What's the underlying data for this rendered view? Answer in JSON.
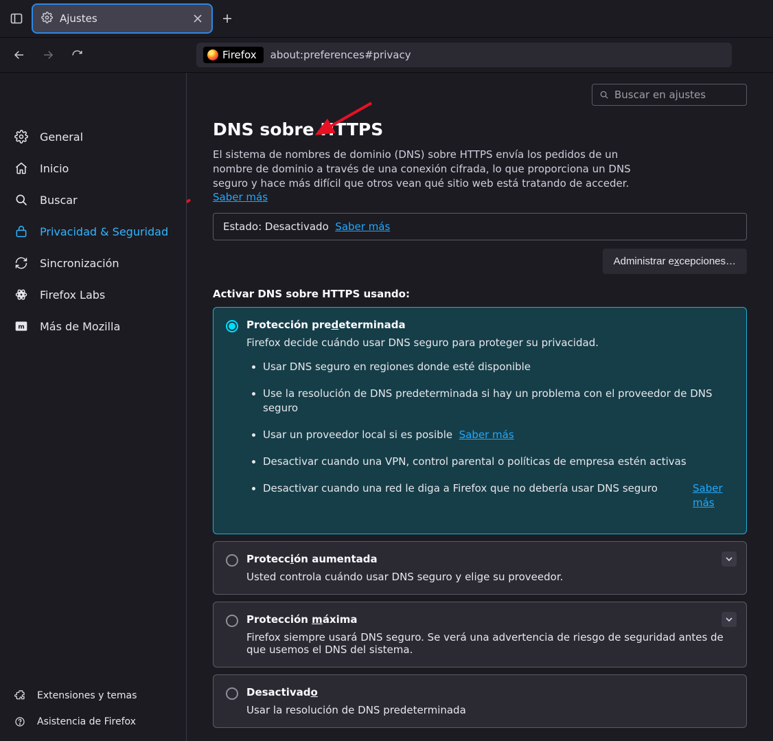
{
  "tab": {
    "title": "Ajustes"
  },
  "urlbar": {
    "brand": "Firefox",
    "url": "about:preferences#privacy"
  },
  "sidebar": {
    "items": [
      {
        "label": "General"
      },
      {
        "label": "Inicio"
      },
      {
        "label": "Buscar"
      },
      {
        "label": "Privacidad & Seguridad"
      },
      {
        "label": "Sincronización"
      },
      {
        "label": "Firefox Labs"
      },
      {
        "label": "Más de Mozilla"
      }
    ],
    "footer": [
      {
        "label": "Extensiones y temas"
      },
      {
        "label": "Asistencia de Firefox"
      }
    ]
  },
  "search": {
    "placeholder": "Buscar en ajustes"
  },
  "section": {
    "title": "DNS sobre HTTPS",
    "desc": "El sistema de nombres de dominio (DNS) sobre HTTPS envía los pedidos de un nombre de dominio a través de una conexión cifrada, lo que proporciona un DNS seguro y hace más difícil que otros vean qué sitio web está tratando de acceder.",
    "learn": "Saber más",
    "status_label": "Estado: ",
    "status_value": "Desactivado",
    "status_learn": "Saber más",
    "manage_btn_pre": "Administrar e",
    "manage_btn_u": "x",
    "manage_btn_post": "cepciones…",
    "activate_label": "Activar DNS sobre HTTPS usando:"
  },
  "options": {
    "default": {
      "title_pre": "Protección pre",
      "title_u": "d",
      "title_post": "eterminada",
      "desc": "Firefox decide cuándo usar DNS seguro para proteger su privacidad.",
      "bullets": [
        "Usar DNS seguro en regiones donde esté disponible",
        "Use la resolución de DNS predeterminada si hay un problema con el proveedor de DNS seguro",
        "Usar un proveedor local si es posible",
        "Desactivar cuando una VPN, control parental o políticas de empresa estén activas",
        "Desactivar cuando una red le diga a Firefox que no debería usar DNS seguro"
      ],
      "bullet3_link": "Saber más",
      "bullet5_link": "Saber más"
    },
    "increased": {
      "title_pre": "Protecc",
      "title_u": "i",
      "title_post": "ón aumentada",
      "desc": "Usted controla cuándo usar DNS seguro y elige su proveedor."
    },
    "max": {
      "title_pre": "Protección ",
      "title_u": "m",
      "title_post": "áxima",
      "desc": "Firefox siempre usará DNS seguro. Se verá una advertencia de riesgo de seguridad antes de que usemos el DNS del sistema."
    },
    "off": {
      "title_pre": "Desactivad",
      "title_u": "o",
      "title_post": "",
      "desc": "Usar la resolución de DNS predeterminada"
    }
  }
}
